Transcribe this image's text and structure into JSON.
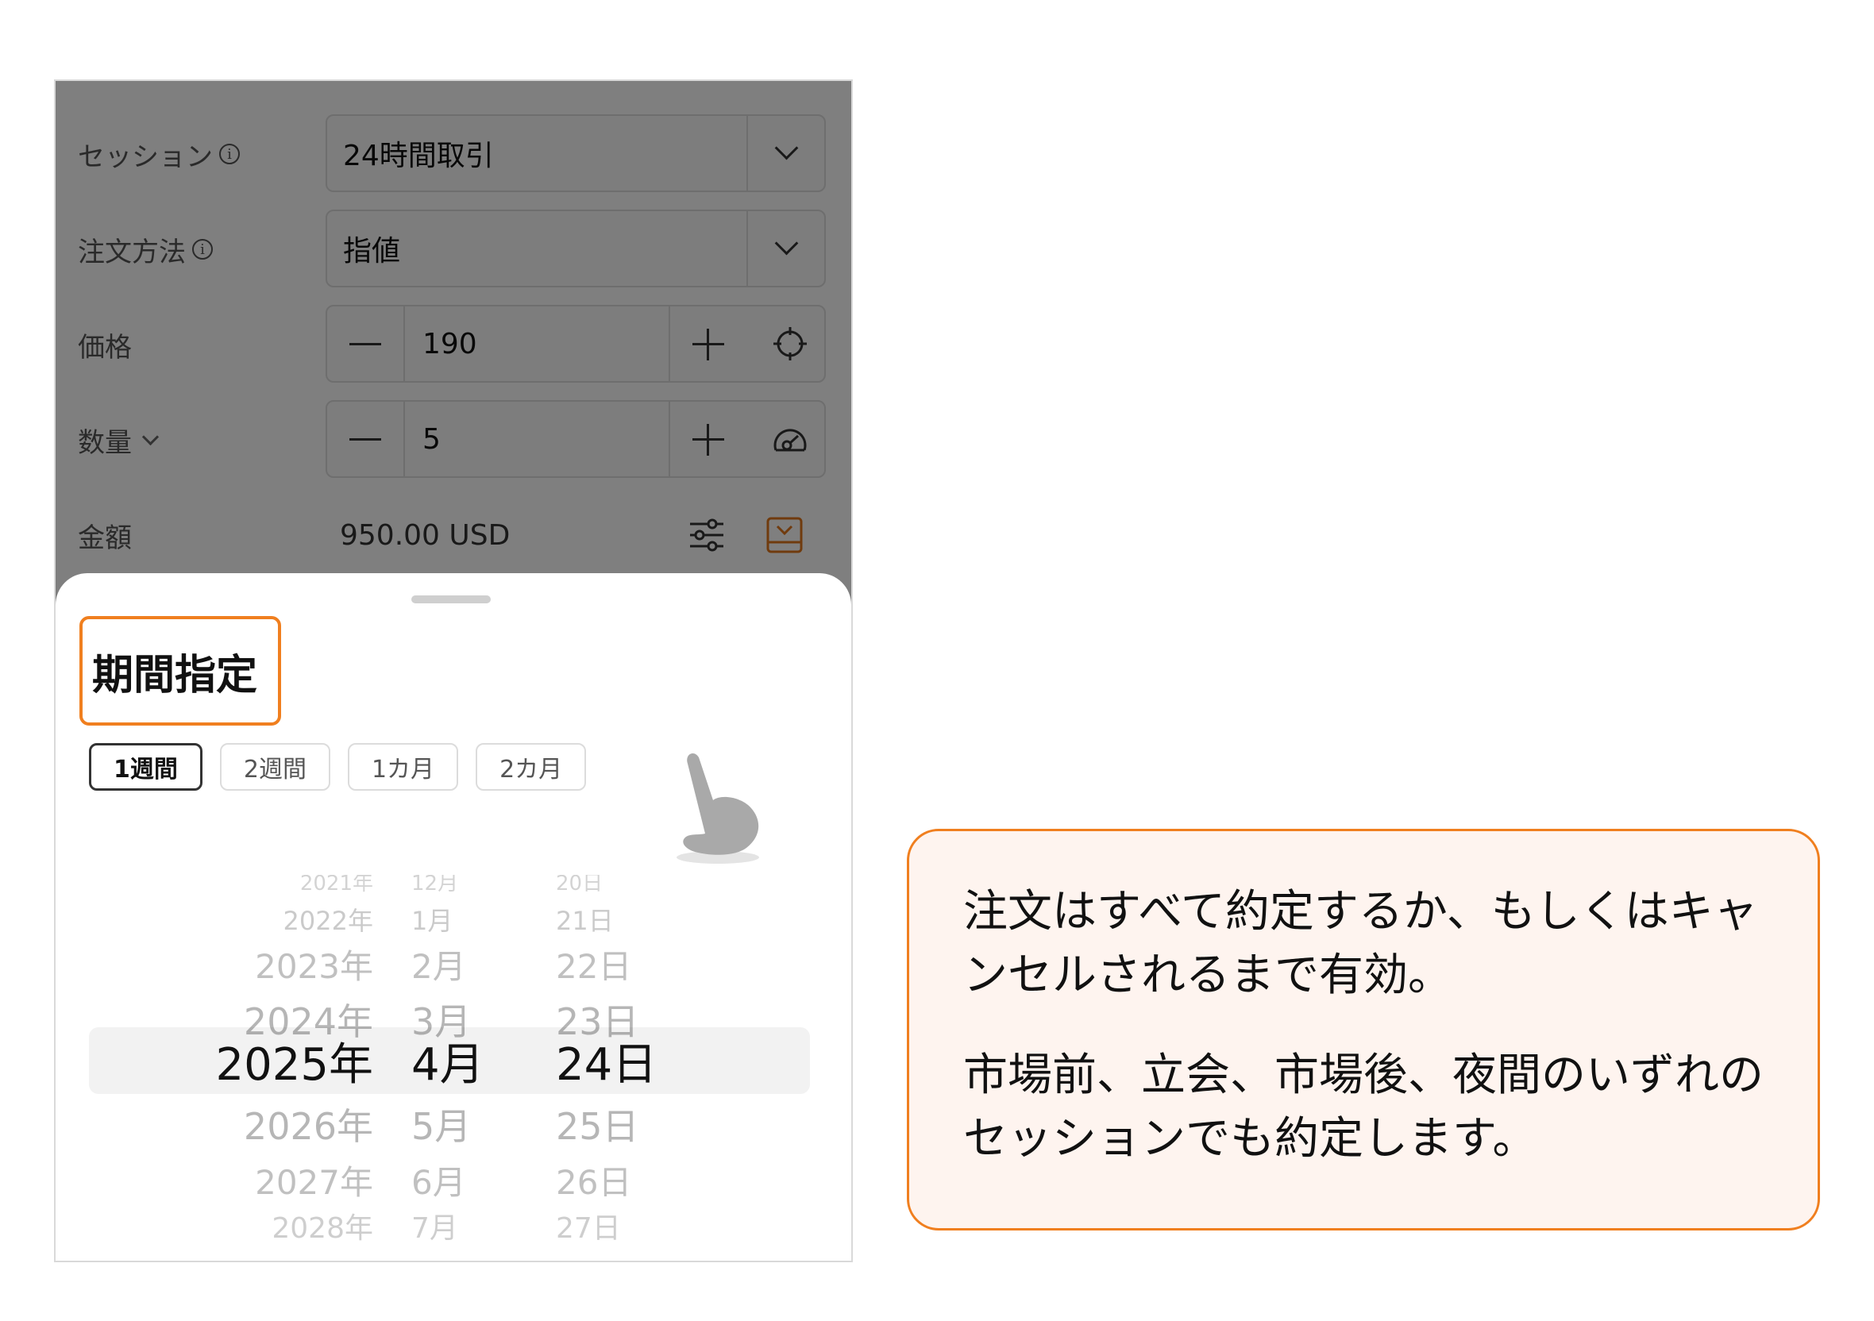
{
  "form": {
    "session": {
      "label": "セッション",
      "value": "24時間取引"
    },
    "order_type": {
      "label": "注文方法",
      "value": "指値"
    },
    "price": {
      "label": "価格",
      "value": "190"
    },
    "quantity": {
      "label": "数量",
      "value": "5"
    },
    "amount": {
      "label": "金額",
      "value": "950.00 USD"
    },
    "info_glyph": "i"
  },
  "sheet": {
    "title": "期間指定",
    "chips": [
      "1週間",
      "2週間",
      "1カ月",
      "2カ月"
    ],
    "active_chip": "1週間",
    "picker": {
      "rows": [
        {
          "year": "2021年",
          "month": "12月",
          "day": "20日"
        },
        {
          "year": "2022年",
          "month": "1月",
          "day": "21日"
        },
        {
          "year": "2023年",
          "month": "2月",
          "day": "22日"
        },
        {
          "year": "2024年",
          "month": "3月",
          "day": "23日"
        },
        {
          "year": "2025年",
          "month": "4月",
          "day": "24日"
        },
        {
          "year": "2026年",
          "month": "5月",
          "day": "25日"
        },
        {
          "year": "2027年",
          "month": "6月",
          "day": "26日"
        },
        {
          "year": "2028年",
          "month": "7月",
          "day": "27日"
        }
      ],
      "selected": {
        "year": "2025年",
        "month": "4月",
        "day": "24日"
      }
    }
  },
  "info_card": {
    "paragraph1": "注文はすべて約定するか、もしくはキャンセルされるまで有効。",
    "paragraph2": "市場前、立会、市場後、夜間のいずれのセッションでも約定します。"
  },
  "colors": {
    "accent": "#f07f1f",
    "card_background": "#fef4ef",
    "overlay": "rgba(0,0,0,0.5)"
  },
  "icons": [
    "info-icon",
    "chevron-down-icon",
    "minus-icon",
    "plus-icon",
    "crosshair-icon",
    "speedometer-icon",
    "sliders-icon",
    "collapse-panel-icon",
    "pointing-hand-icon"
  ]
}
